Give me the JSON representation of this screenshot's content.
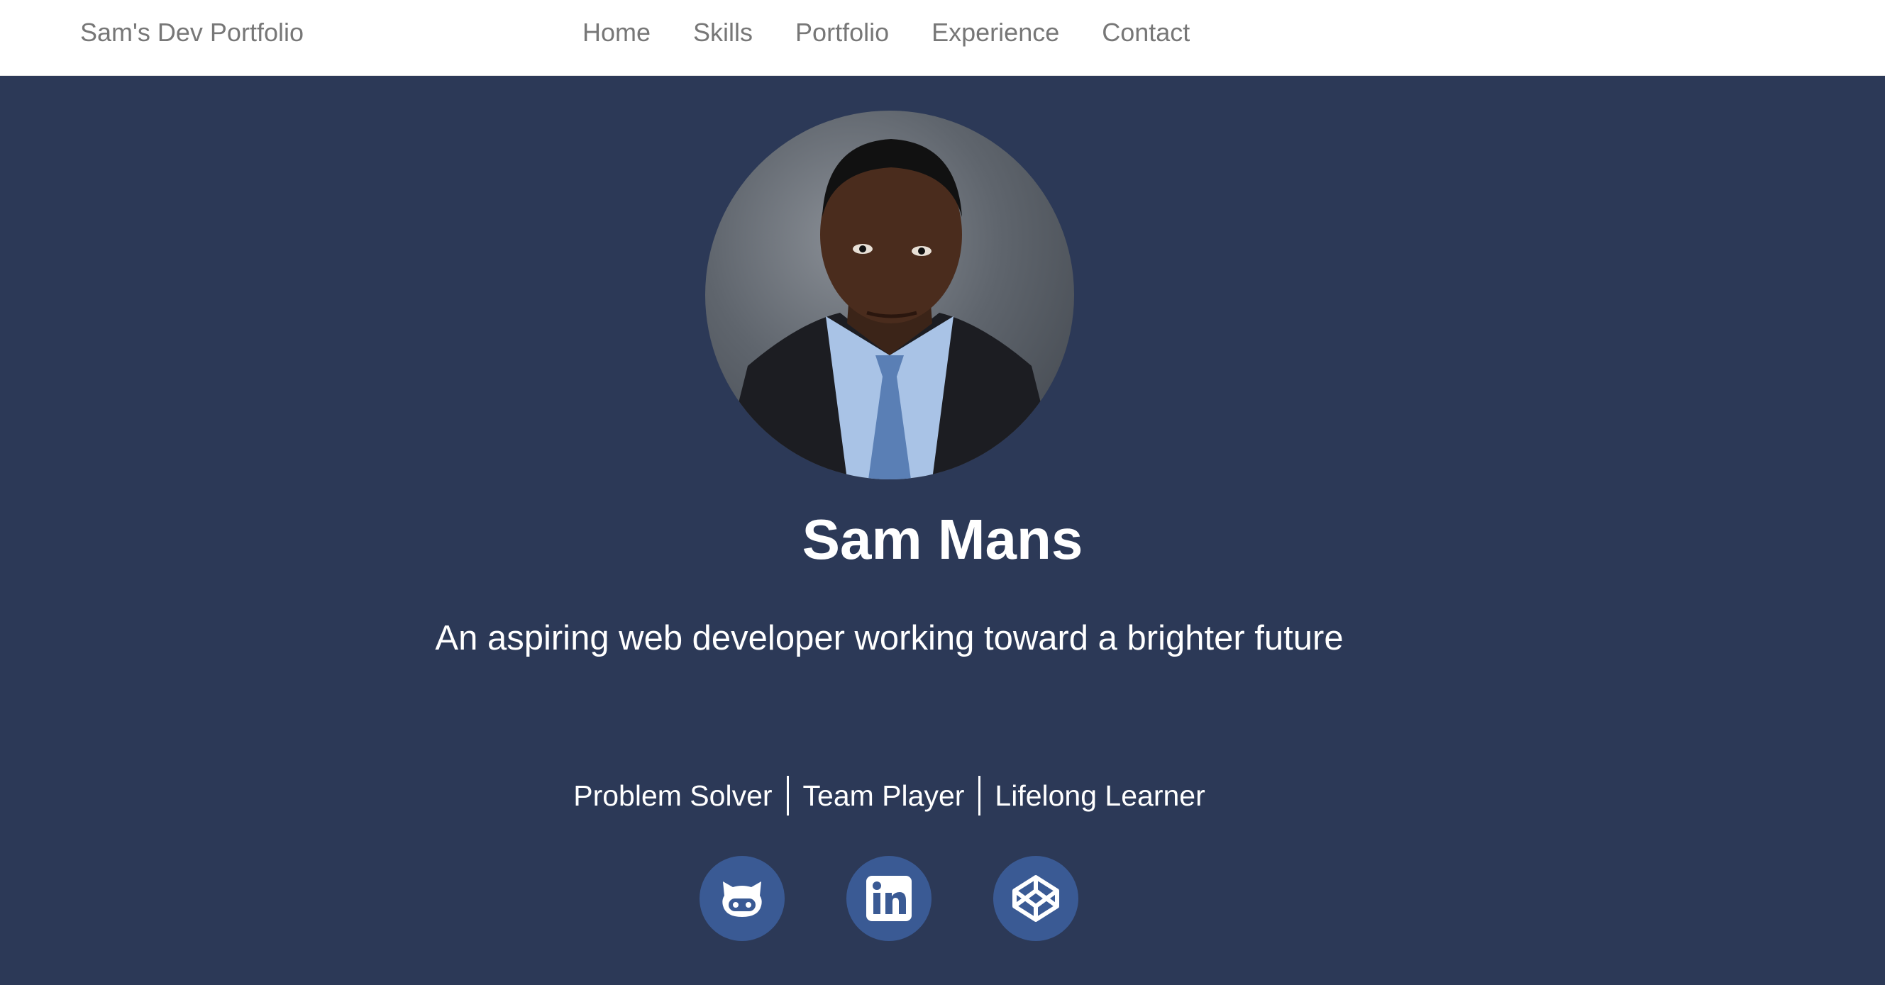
{
  "navbar": {
    "brand": "Sam's Dev Portfolio",
    "links": [
      "Home",
      "Skills",
      "Portfolio",
      "Experience",
      "Contact"
    ]
  },
  "hero": {
    "name": "Sam Mans",
    "tagline": "An aspiring web developer working toward a brighter future",
    "traits": [
      "Problem Solver",
      "Team Player",
      "Lifelong Learner"
    ]
  },
  "social": {
    "icons": [
      "github-icon",
      "linkedin-icon",
      "codepen-icon"
    ]
  },
  "colors": {
    "hero_background": "#2c3957",
    "social_button": "#3a5a94",
    "nav_text": "#777777"
  }
}
